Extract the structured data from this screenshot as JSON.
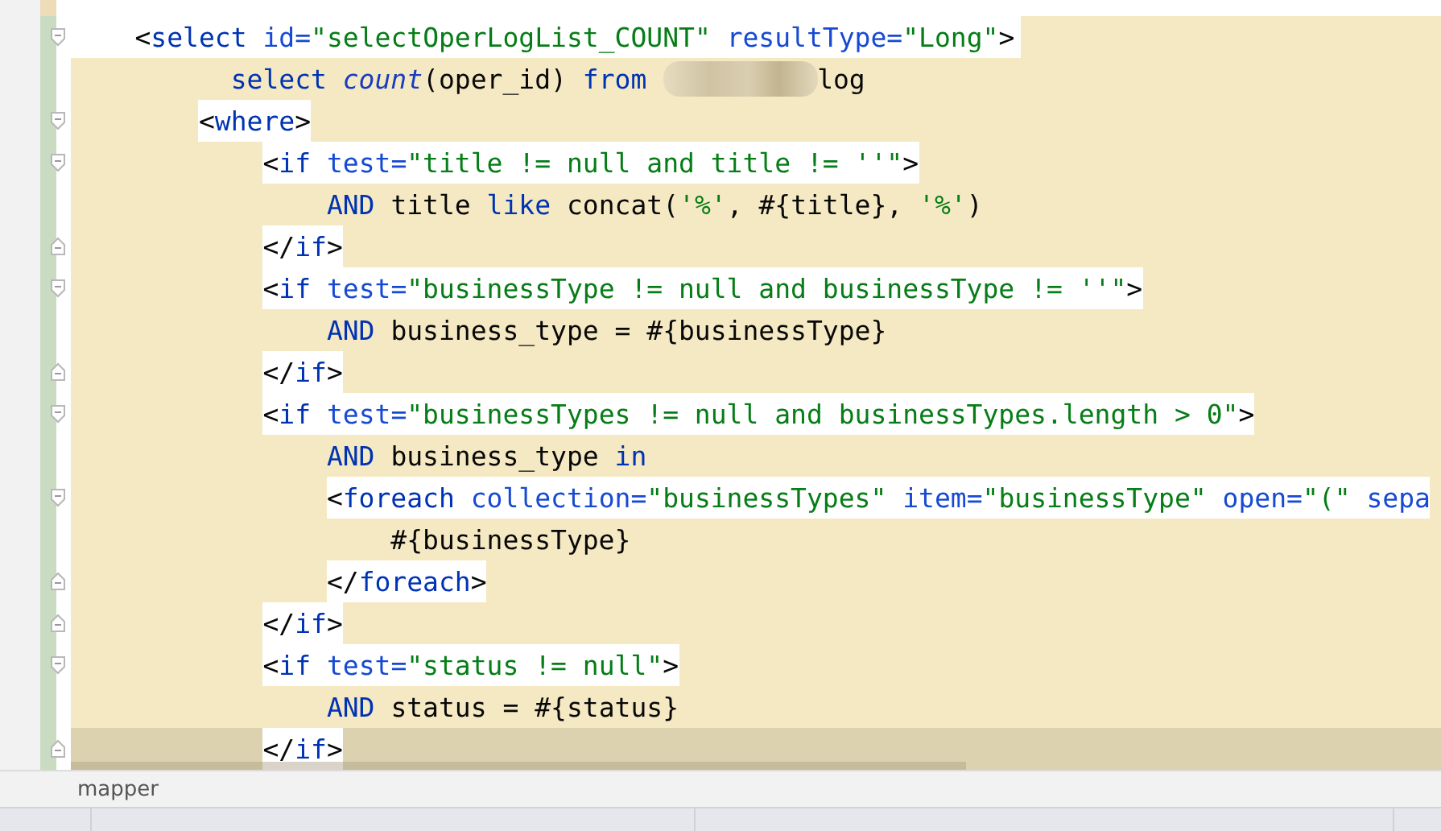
{
  "editor": {
    "lines": [
      {
        "fold_start": true,
        "fold_end": false,
        "current": false,
        "tokens": [
          {
            "t": "    <",
            "kind": "punct"
          },
          {
            "t": "select ",
            "kind": "tag"
          },
          {
            "t": "id=",
            "kind": "attr"
          },
          {
            "t": "\"selectOperLogList_COUNT\" ",
            "kind": "value"
          },
          {
            "t": "resultType=",
            "kind": "attr"
          },
          {
            "t": "\"Long\"",
            "kind": "value"
          },
          {
            "t": ">",
            "kind": "punct"
          }
        ]
      },
      {
        "fold_start": false,
        "fold_end": false,
        "current": false,
        "tokens": [
          {
            "t": "          select ",
            "kind": "keyword"
          },
          {
            "t": "count",
            "kind": "function"
          },
          {
            "t": "(oper_id) ",
            "kind": "plain"
          },
          {
            "t": "from ",
            "kind": "keyword"
          },
          {
            "kind": "blur"
          },
          {
            "t": "log",
            "kind": "plain"
          }
        ]
      },
      {
        "fold_start": true,
        "fold_end": false,
        "current": false,
        "tokens": [
          {
            "t": "        <",
            "kind": "punct"
          },
          {
            "t": "where",
            "kind": "tag"
          },
          {
            "t": ">",
            "kind": "punct"
          }
        ]
      },
      {
        "fold_start": true,
        "fold_end": false,
        "current": false,
        "tokens": [
          {
            "t": "            <",
            "kind": "punct"
          },
          {
            "t": "if ",
            "kind": "tag"
          },
          {
            "t": "test=",
            "kind": "attr"
          },
          {
            "t": "\"title != null and title != ''\"",
            "kind": "value"
          },
          {
            "t": ">",
            "kind": "punct"
          }
        ]
      },
      {
        "fold_start": false,
        "fold_end": false,
        "current": false,
        "tokens": [
          {
            "t": "                AND ",
            "kind": "keyword"
          },
          {
            "t": "title ",
            "kind": "plain"
          },
          {
            "t": "like ",
            "kind": "keyword"
          },
          {
            "t": "concat(",
            "kind": "plain"
          },
          {
            "t": "'%'",
            "kind": "string"
          },
          {
            "t": ", #{title}, ",
            "kind": "plain"
          },
          {
            "t": "'%'",
            "kind": "string"
          },
          {
            "t": ")",
            "kind": "plain"
          }
        ]
      },
      {
        "fold_start": false,
        "fold_end": true,
        "current": false,
        "tokens": [
          {
            "t": "            </",
            "kind": "punct"
          },
          {
            "t": "if",
            "kind": "tag"
          },
          {
            "t": ">",
            "kind": "punct"
          }
        ]
      },
      {
        "fold_start": true,
        "fold_end": false,
        "current": false,
        "tokens": [
          {
            "t": "            <",
            "kind": "punct"
          },
          {
            "t": "if ",
            "kind": "tag"
          },
          {
            "t": "test=",
            "kind": "attr"
          },
          {
            "t": "\"businessType != null and businessType != ''\"",
            "kind": "value"
          },
          {
            "t": ">",
            "kind": "punct"
          }
        ]
      },
      {
        "fold_start": false,
        "fold_end": false,
        "current": false,
        "tokens": [
          {
            "t": "                AND ",
            "kind": "keyword"
          },
          {
            "t": "business_type = #{businessType}",
            "kind": "plain"
          }
        ]
      },
      {
        "fold_start": false,
        "fold_end": true,
        "current": false,
        "tokens": [
          {
            "t": "            </",
            "kind": "punct"
          },
          {
            "t": "if",
            "kind": "tag"
          },
          {
            "t": ">",
            "kind": "punct"
          }
        ]
      },
      {
        "fold_start": true,
        "fold_end": false,
        "current": false,
        "tokens": [
          {
            "t": "            <",
            "kind": "punct"
          },
          {
            "t": "if ",
            "kind": "tag"
          },
          {
            "t": "test=",
            "kind": "attr"
          },
          {
            "t": "\"businessTypes != null and businessTypes.length > 0\"",
            "kind": "value"
          },
          {
            "t": ">",
            "kind": "punct"
          }
        ]
      },
      {
        "fold_start": false,
        "fold_end": false,
        "current": false,
        "tokens": [
          {
            "t": "                AND ",
            "kind": "keyword"
          },
          {
            "t": "business_type ",
            "kind": "plain"
          },
          {
            "t": "in",
            "kind": "keyword"
          }
        ]
      },
      {
        "fold_start": true,
        "fold_end": false,
        "current": false,
        "tokens": [
          {
            "t": "                <",
            "kind": "punct"
          },
          {
            "t": "foreach ",
            "kind": "tag"
          },
          {
            "t": "collection=",
            "kind": "attr"
          },
          {
            "t": "\"businessTypes\" ",
            "kind": "value"
          },
          {
            "t": "item=",
            "kind": "attr"
          },
          {
            "t": "\"businessType\" ",
            "kind": "value"
          },
          {
            "t": "open=",
            "kind": "attr"
          },
          {
            "t": "\"(\" ",
            "kind": "value"
          },
          {
            "t": "sepa",
            "kind": "attr"
          }
        ]
      },
      {
        "fold_start": false,
        "fold_end": false,
        "current": false,
        "tokens": [
          {
            "t": "                    #{businessType}",
            "kind": "plain"
          }
        ]
      },
      {
        "fold_start": false,
        "fold_end": true,
        "current": false,
        "tokens": [
          {
            "t": "                </",
            "kind": "punct"
          },
          {
            "t": "foreach",
            "kind": "tag"
          },
          {
            "t": ">",
            "kind": "punct"
          }
        ]
      },
      {
        "fold_start": false,
        "fold_end": true,
        "current": false,
        "tokens": [
          {
            "t": "            </",
            "kind": "punct"
          },
          {
            "t": "if",
            "kind": "tag"
          },
          {
            "t": ">",
            "kind": "punct"
          }
        ]
      },
      {
        "fold_start": true,
        "fold_end": false,
        "current": false,
        "tokens": [
          {
            "t": "            <",
            "kind": "punct"
          },
          {
            "t": "if ",
            "kind": "tag"
          },
          {
            "t": "test=",
            "kind": "attr"
          },
          {
            "t": "\"status != null\"",
            "kind": "value"
          },
          {
            "t": ">",
            "kind": "punct"
          }
        ]
      },
      {
        "fold_start": false,
        "fold_end": false,
        "current": false,
        "tokens": [
          {
            "t": "                AND ",
            "kind": "keyword"
          },
          {
            "t": "status = #{status}",
            "kind": "plain"
          }
        ]
      },
      {
        "fold_start": false,
        "fold_end": true,
        "current": true,
        "tokens": [
          {
            "t": "            </",
            "kind": "punct"
          },
          {
            "t": "if",
            "kind": "tag"
          },
          {
            "t": ">",
            "kind": "punct"
          }
        ]
      }
    ]
  },
  "breadcrumb": {
    "items": [
      "mapper"
    ]
  }
}
